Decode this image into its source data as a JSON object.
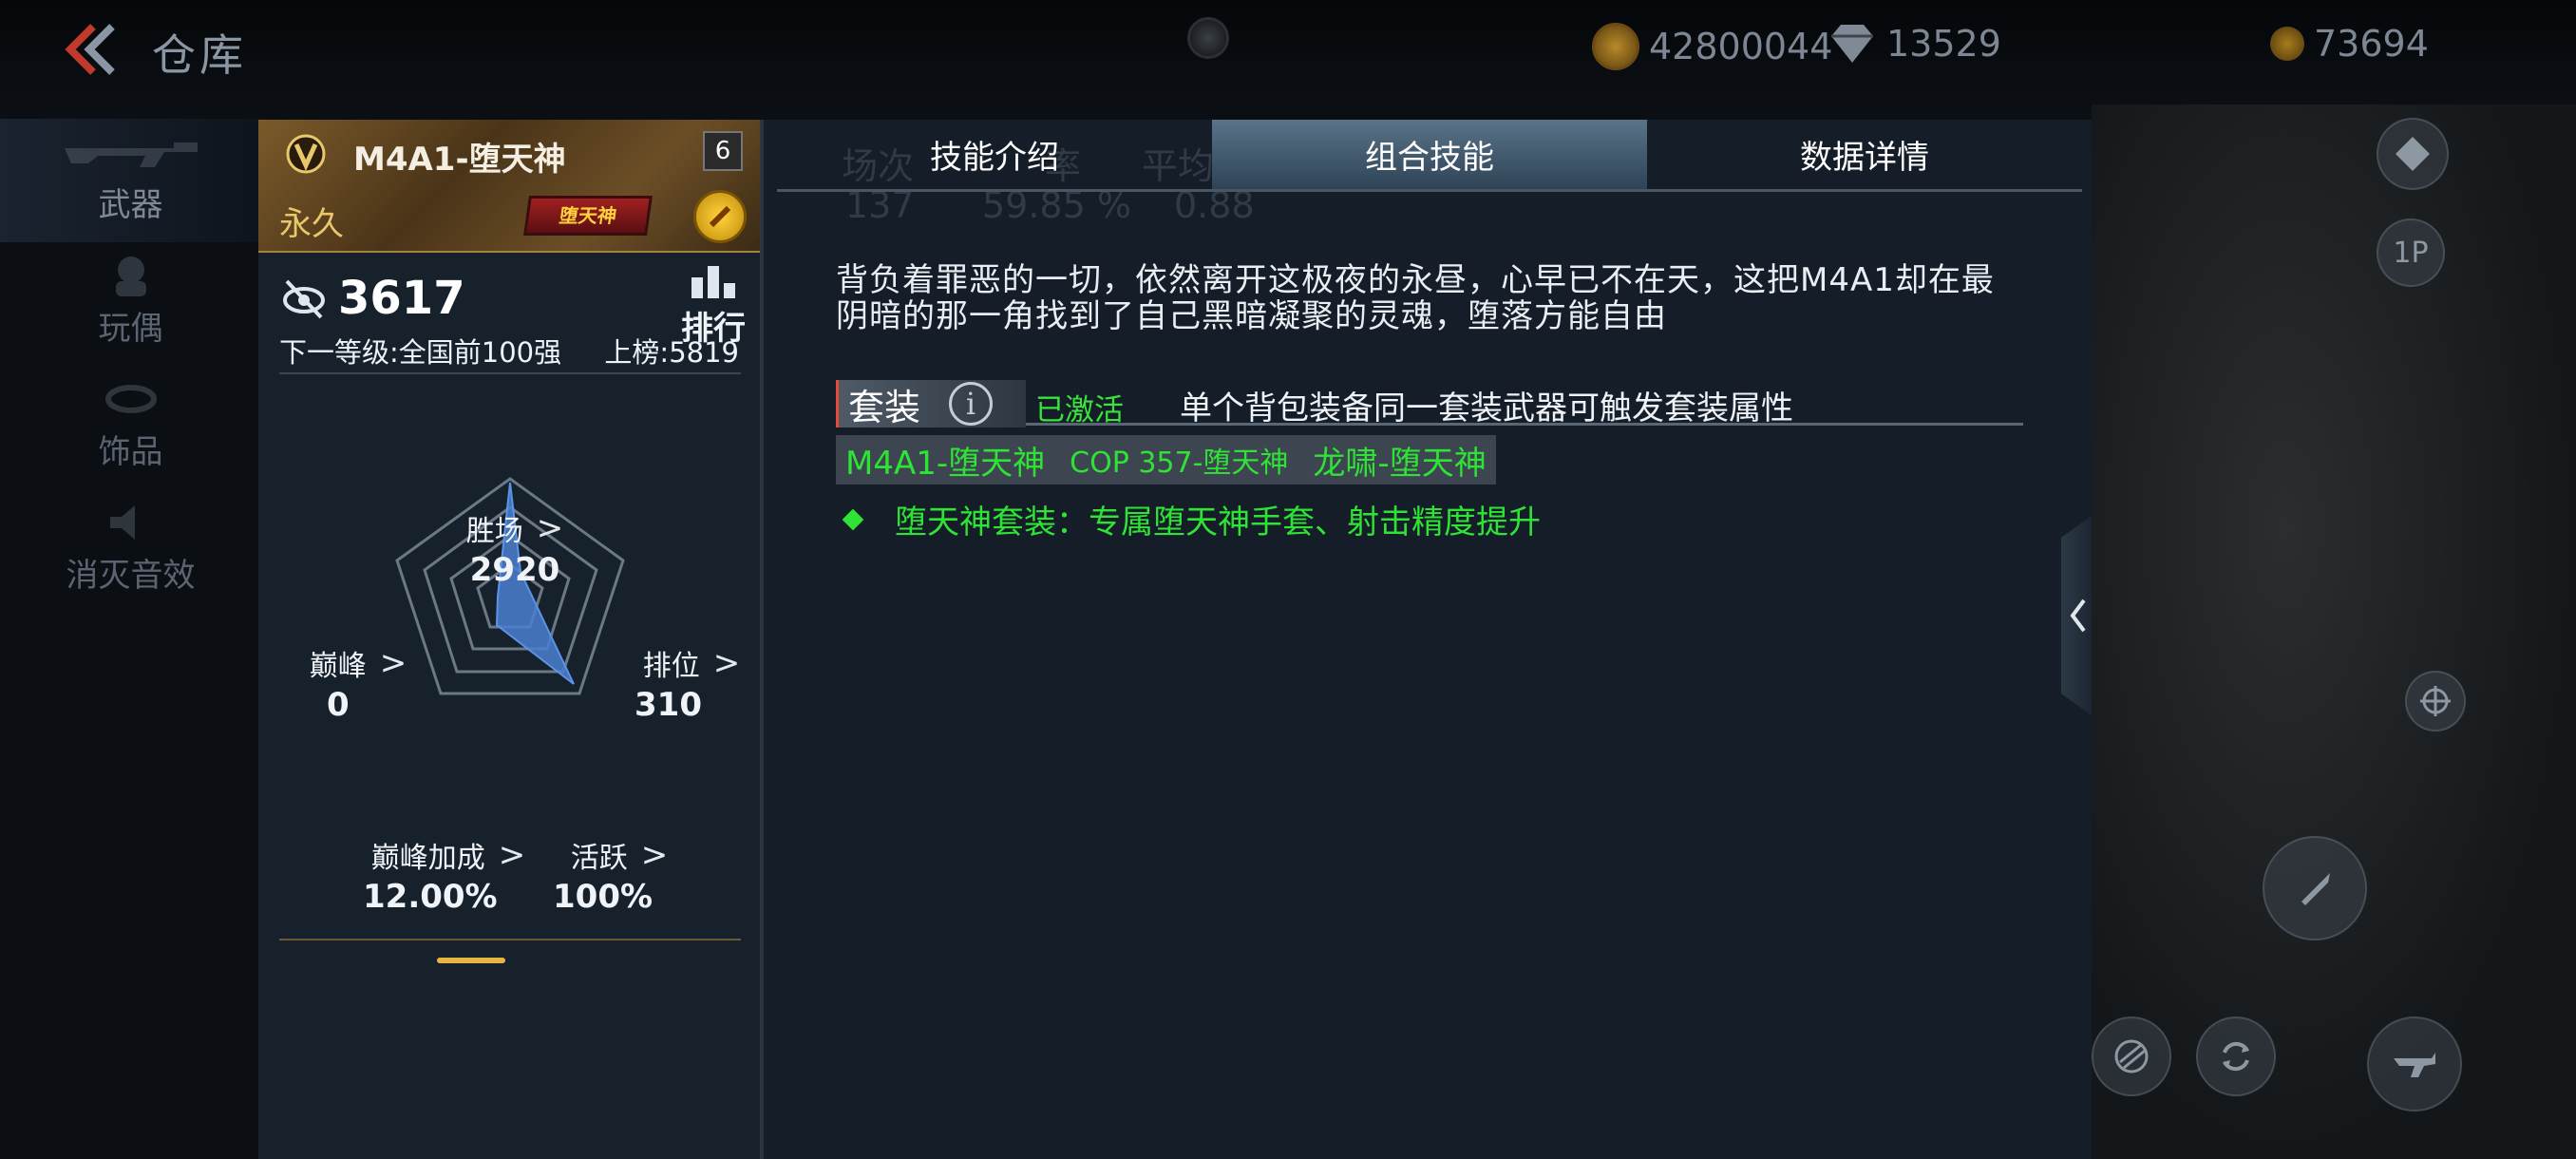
{
  "header": {
    "title": "仓库",
    "gold": "42800044",
    "diamonds": "13529",
    "coins": "73694"
  },
  "categories": [
    {
      "label": "武器",
      "icon": "rifle-icon"
    },
    {
      "label": "玩偶",
      "icon": "doll-icon"
    },
    {
      "label": "饰品",
      "icon": "ornament-icon"
    },
    {
      "label": "消灭音效",
      "icon": "sound-icon"
    }
  ],
  "weapon": {
    "name": "M4A1-堕天神",
    "level": "6",
    "duration": "永久",
    "skin_badge": "堕天神",
    "score": "3617",
    "rank_label": "排行",
    "next_level": "下一等级:全国前100强",
    "on_board": "上榜:5819",
    "stats": {
      "wins": {
        "label": "胜场",
        "value": "2920"
      },
      "peak": {
        "label": "巅峰",
        "value": "0"
      },
      "ranked": {
        "label": "排位",
        "value": "310"
      },
      "peak_bonus": {
        "label": "巅峰加成",
        "value": "12.00%"
      },
      "active": {
        "label": "活跃",
        "value": "100%"
      }
    }
  },
  "tabs": [
    {
      "label": "技能介绍",
      "active": false
    },
    {
      "label": "组合技能",
      "active": true
    },
    {
      "label": "数据详情",
      "active": false
    }
  ],
  "ghost_header": {
    "matches": "场次",
    "rate_suffix": "率",
    "kda": "平均KDA",
    "matches_value": "137",
    "rate_value": "59.85 %",
    "kda_value": "0.88"
  },
  "description": "背负着罪恶的一切，依然离开这极夜的永昼，心早已不在天，这把M4A1却在最阴暗的那一角找到了自己黑暗凝聚的灵魂，堕落方能自由",
  "set": {
    "tag": "套装",
    "status": "已激活",
    "hint": "单个背包装备同一套装武器可触发套装属性",
    "members": [
      "M4A1-堕天神",
      "COP 357-堕天神",
      "龙啸-堕天神"
    ],
    "bonus": "堕天神套装：专属堕天神手套、射击精度提升"
  },
  "scene": {
    "view_mode": "1P"
  },
  "colors": {
    "accent_green": "#2fe336",
    "gold": "#e8c86a",
    "tab_active": "#4a6376"
  }
}
